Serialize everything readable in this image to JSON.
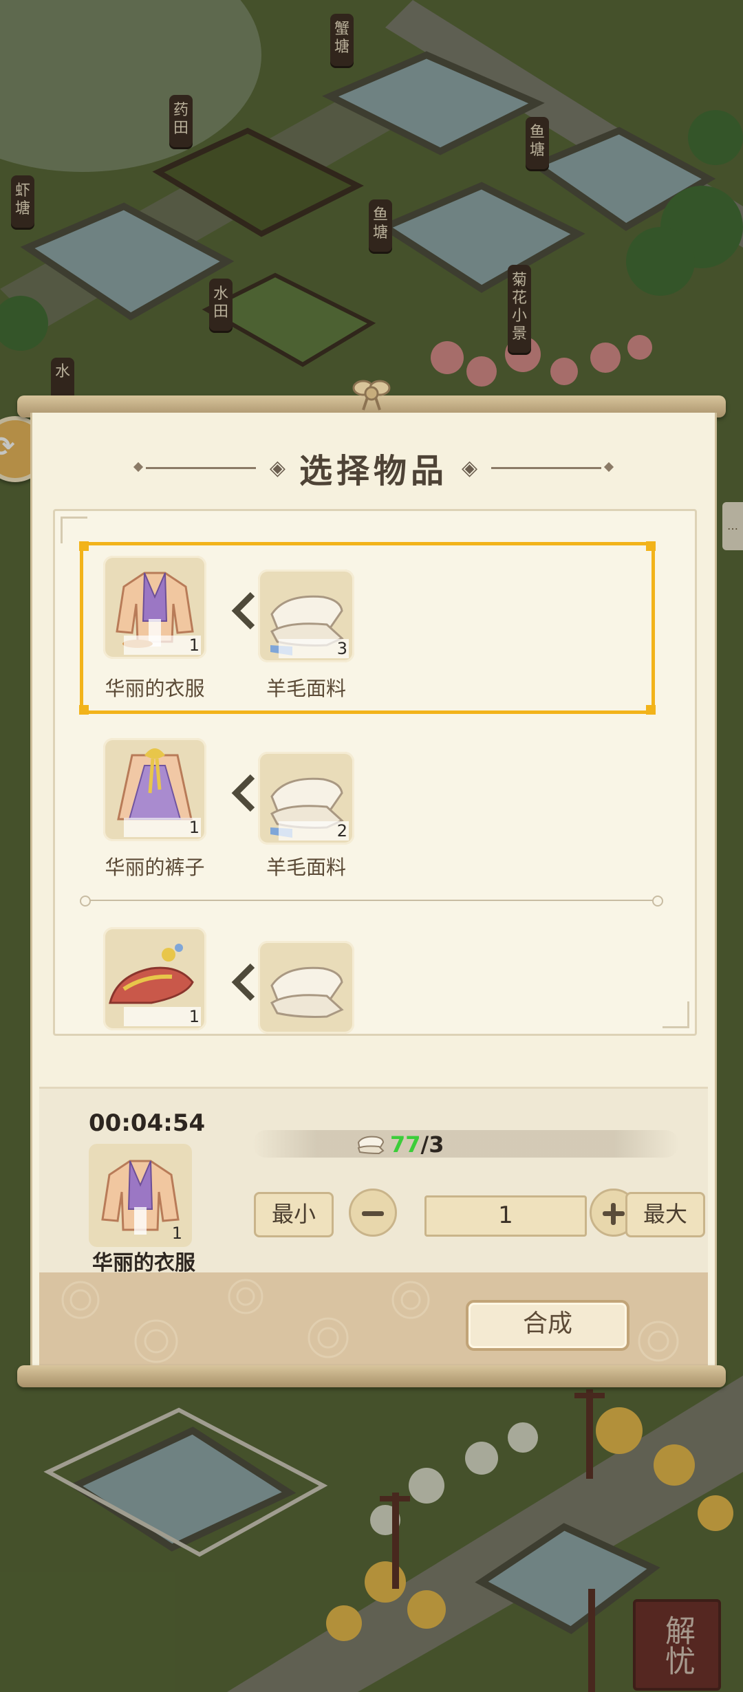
{
  "map_signs": [
    {
      "id": "crab-pond",
      "text": "蟹\n塘"
    },
    {
      "id": "herb-field",
      "text": "药\n田"
    },
    {
      "id": "shrimp-pond",
      "text": "虾\n塘"
    },
    {
      "id": "fish-pond-1",
      "text": "鱼\n塘"
    },
    {
      "id": "fish-pond-2",
      "text": "鱼\n塘"
    },
    {
      "id": "paddy",
      "text": "水\n田"
    },
    {
      "id": "chrysanthemum",
      "text": "菊\n花\n小\n景"
    },
    {
      "id": "water",
      "text": "水"
    }
  ],
  "dialog": {
    "title": "选择物品",
    "recipes": [
      {
        "product": {
          "name": "华丽的衣服",
          "qty": "1",
          "icon": "purple-robe-icon"
        },
        "material": {
          "name": "羊毛面料",
          "qty": "3",
          "icon": "wool-fabric-icon"
        },
        "selected": true
      },
      {
        "product": {
          "name": "华丽的裤子",
          "qty": "1",
          "icon": "purple-skirt-icon"
        },
        "material": {
          "name": "羊毛面料",
          "qty": "2",
          "icon": "wool-fabric-icon"
        },
        "selected": false
      },
      {
        "product": {
          "name": "",
          "qty": "1",
          "icon": "red-shoes-icon"
        },
        "material": {
          "name": "",
          "qty": "",
          "icon": "wool-fabric-icon"
        },
        "selected": false
      }
    ],
    "craft": {
      "timer": "00:04:54",
      "item_name": "华丽的衣服",
      "item_qty": "1",
      "material_have": "77",
      "material_need": "/3",
      "min_label": "最小",
      "max_label": "最大",
      "quantity": "1",
      "confirm_label": "合成"
    }
  },
  "seal_text": "解忧",
  "colors": {
    "selection": "#f2b31a",
    "material_ok": "#3ccd3a",
    "panel": "#f6f1de"
  }
}
